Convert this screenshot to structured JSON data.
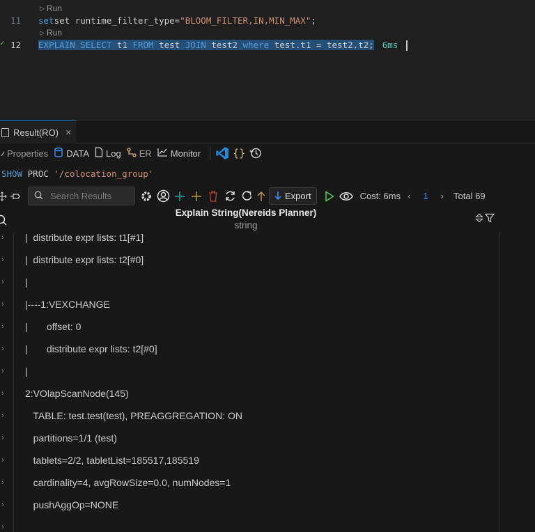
{
  "editor": {
    "lines": [
      {
        "number": "11",
        "codelens": "Run",
        "prefix": "set runtime_filter_type=",
        "string": "\"BLOOM_FILTER,IN,MIN_MAX\"",
        "suffix": ";"
      },
      {
        "number": "12",
        "codelens": "Run",
        "tokens": [
          "EXPLAIN",
          " ",
          "SELECT",
          " t1 ",
          "FROM",
          " test ",
          "JOIN",
          " test2 ",
          "where",
          " test.t1 = test2.t2;"
        ],
        "timing": "6ms"
      }
    ]
  },
  "panel": {
    "tab": {
      "label": "Result(RO)",
      "close": "×"
    },
    "toolbar1": {
      "properties": "Properties",
      "data": "DATA",
      "log": "Log",
      "er": "ER",
      "monitor": "Monitor",
      "braces": "{}"
    },
    "proc": {
      "keyword1": "SHOW",
      "keyword2": "PROC",
      "string": "'/colocation_group'"
    },
    "toolbar2": {
      "search_placeholder": "Search Results",
      "export": "Export",
      "cost": "Cost: 6ms",
      "page": "1",
      "total": "Total 69"
    },
    "grid": {
      "column": {
        "title": "Explain String(Nereids Planner)",
        "type": "string"
      },
      "rows": [
        "|  distribute expr lists: t1[#1]",
        "|  distribute expr lists: t2[#0]",
        "|",
        "|----1:VEXCHANGE",
        "|       offset: 0",
        "|       distribute expr lists: t2[#0]",
        "|",
        "2:VOlapScanNode(145)",
        "   TABLE: test.test(test), PREAGGREGATION: ON",
        "   partitions=1/1 (test)",
        "   tablets=2/2, tabletList=185517,185519",
        "   cardinality=4, avgRowSize=0.0, numNodes=1",
        "   pushAggOp=NONE",
        ""
      ]
    }
  },
  "colors": {
    "background": "#1f1f1f",
    "keyword": "#569cd6",
    "string": "#ce9178",
    "timing": "#4ec9b0",
    "accent_blue": "#3794ff",
    "green": "#4ec94e",
    "yellow": "#d7ba7d",
    "red": "#f14c4c",
    "selection": "#264f78"
  },
  "icons": [
    "play-icon",
    "check-icon",
    "file-icon",
    "close-icon",
    "properties-icon",
    "database-icon",
    "log-icon",
    "er-icon",
    "monitor-icon",
    "vscode-icon",
    "braces-icon",
    "history-icon",
    "move-icon",
    "pin-icon",
    "search-icon",
    "gear-icon",
    "user-icon",
    "add-icon",
    "add-row-icon",
    "delete-icon",
    "refresh-icon",
    "reload-icon",
    "upload-icon",
    "download-icon",
    "run-icon",
    "eye-icon",
    "chevron-left-icon",
    "chevron-right-icon",
    "sort-icon",
    "filter-icon",
    "chevron-right-icon"
  ]
}
